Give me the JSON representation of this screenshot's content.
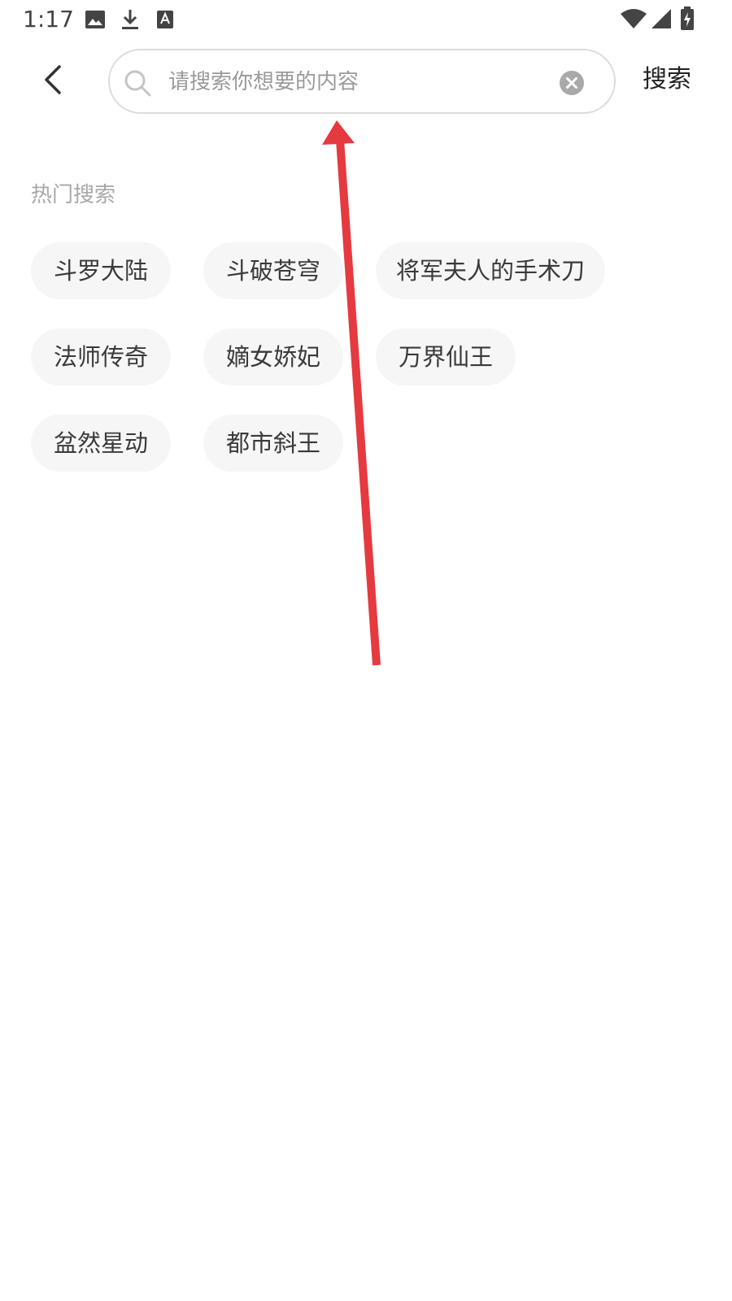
{
  "status_bar": {
    "time": "1:17",
    "icons": [
      "image-icon",
      "download-icon",
      "font-icon",
      "wifi-icon",
      "signal-icon",
      "battery-charging-icon"
    ]
  },
  "header": {
    "back_icon": "chevron-left-icon",
    "search": {
      "placeholder": "请搜索你想要的内容",
      "value": ""
    },
    "submit_label": "搜索"
  },
  "hot_search": {
    "title": "热门搜索",
    "rows": [
      [
        "斗罗大陆",
        "斗破苍穹",
        "将军夫人的手术刀"
      ],
      [
        "法师传奇",
        "嫡女娇妃",
        "万界仙王"
      ],
      [
        "盆然星动",
        "都市斜王"
      ]
    ]
  },
  "colors": {
    "annotation_arrow": "#e53a40",
    "chip_background": "#f6f6f6",
    "section_title": "#a8a8a8"
  }
}
